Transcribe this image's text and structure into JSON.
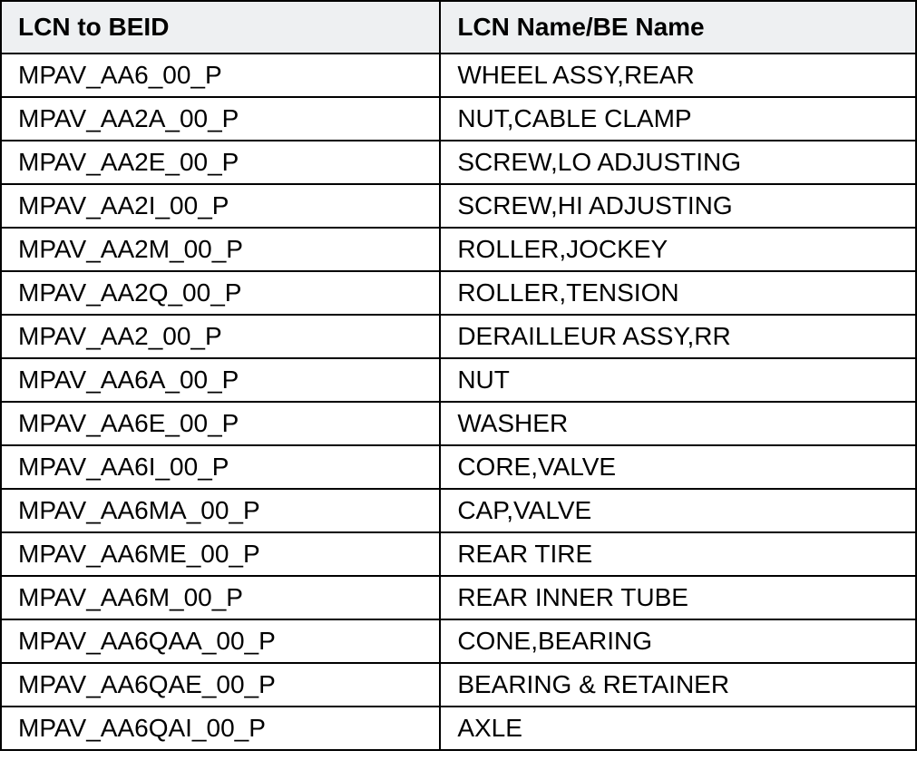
{
  "table": {
    "headers": {
      "col1": "LCN to BEID",
      "col2": "LCN Name/BE Name"
    },
    "rows": [
      {
        "lcn": "MPAV_AA6_00_P",
        "name": "WHEEL ASSY,REAR"
      },
      {
        "lcn": "MPAV_AA2A_00_P",
        "name": "NUT,CABLE CLAMP"
      },
      {
        "lcn": "MPAV_AA2E_00_P",
        "name": "SCREW,LO ADJUSTING"
      },
      {
        "lcn": "MPAV_AA2I_00_P",
        "name": "SCREW,HI ADJUSTING"
      },
      {
        "lcn": "MPAV_AA2M_00_P",
        "name": "ROLLER,JOCKEY"
      },
      {
        "lcn": "MPAV_AA2Q_00_P",
        "name": "ROLLER,TENSION"
      },
      {
        "lcn": "MPAV_AA2_00_P",
        "name": "DERAILLEUR ASSY,RR"
      },
      {
        "lcn": "MPAV_AA6A_00_P",
        "name": "NUT"
      },
      {
        "lcn": "MPAV_AA6E_00_P",
        "name": "WASHER"
      },
      {
        "lcn": "MPAV_AA6I_00_P",
        "name": "CORE,VALVE"
      },
      {
        "lcn": "MPAV_AA6MA_00_P",
        "name": "CAP,VALVE"
      },
      {
        "lcn": "MPAV_AA6ME_00_P",
        "name": "REAR TIRE"
      },
      {
        "lcn": "MPAV_AA6M_00_P",
        "name": "REAR INNER TUBE"
      },
      {
        "lcn": "MPAV_AA6QAA_00_P",
        "name": "CONE,BEARING"
      },
      {
        "lcn": "MPAV_AA6QAE_00_P",
        "name": "BEARING & RETAINER"
      },
      {
        "lcn": "MPAV_AA6QAI_00_P",
        "name": "AXLE"
      }
    ]
  }
}
